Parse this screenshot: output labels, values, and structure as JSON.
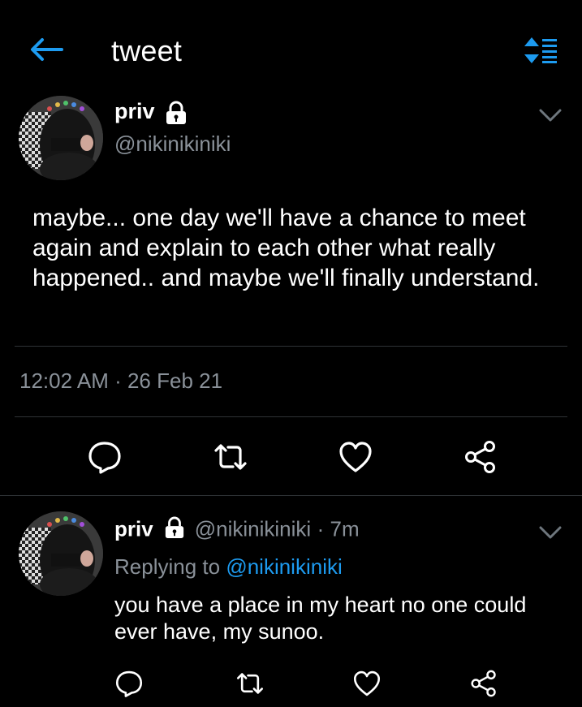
{
  "header": {
    "title": "tweet",
    "back_icon": "arrow-left-icon",
    "sort_icon": "sort-icon",
    "accent": "#1d9bf0"
  },
  "tweet": {
    "name": "priv",
    "handle": "@nikinikiniki",
    "text": "maybe... one day we'll have a chance to meet again and explain to each other what really happened.. and maybe we'll finally understand.",
    "timestamp": "12:02 AM · 26 Feb 21",
    "actions": [
      "reply-icon",
      "retweet-icon",
      "like-icon",
      "share-icon"
    ]
  },
  "reply": {
    "name": "priv",
    "handle": "@nikinikiniki",
    "time": "· 7m",
    "replying_label": "Replying to",
    "replying_to": "@nikinikiniki",
    "text": "you have a place in my heart no one could ever have, my sunoo."
  },
  "colors": {
    "background": "#000000",
    "text": "#ffffff",
    "muted": "#8a9199",
    "separator": "#2f3336"
  }
}
